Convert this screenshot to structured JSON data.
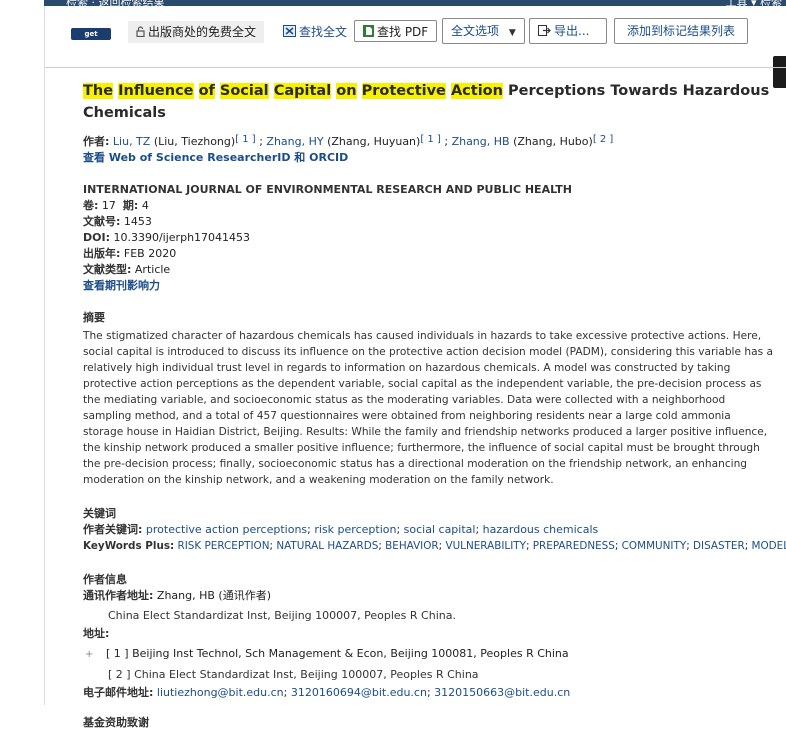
{
  "topbar": {
    "left_text": "检索   ·   返回检索结果",
    "right_text": "工具 ▾    检索"
  },
  "toolbar": {
    "getit_label": "get it@BIT",
    "free_fulltext": "出版商处的免费全文",
    "find_fulltext": "查找全文",
    "find_pdf": "查找 PDF",
    "fulltext_options": "全文选项",
    "export": "导出...",
    "add_to_marked": "添加到标记结果列表"
  },
  "record": {
    "title_highlighted": [
      "The",
      "Influence",
      "of",
      "Social",
      "Capital",
      "on",
      "Protective",
      "Action"
    ],
    "title_rest": "Perceptions Towards Hazardous Chemicals",
    "authors_label": "作者:",
    "authors": [
      {
        "name": "Liu, TZ",
        "full": "(Liu, Tiezhong)",
        "ref": "[ 1 ]"
      },
      {
        "name": "Zhang, HY",
        "full": "(Zhang, Huyuan)",
        "ref": "[ 1 ]"
      },
      {
        "name": "Zhang, HB",
        "full": "(Zhang, Hubo)",
        "ref": "[ 2 ]"
      }
    ],
    "researcher_link": "查看 Web of Science ResearcherID 和 ORCID",
    "journal": "INTERNATIONAL JOURNAL OF ENVIRONMENTAL RESEARCH AND PUBLIC HEALTH",
    "volume_label": "卷:",
    "volume": "17",
    "issue_label": "期:",
    "issue": "4",
    "article_no_label": "文献号:",
    "article_no": "1453",
    "doi_label": "DOI:",
    "doi": "10.3390/ijerph17041453",
    "pub_date_label": "出版年:",
    "pub_date": "FEB 2020",
    "doc_type_label": "文献类型:",
    "doc_type": "Article",
    "journal_impact_link": "查看期刊影响力",
    "abstract_heading": "摘要",
    "abstract": "The stigmatized character of hazardous chemicals has caused individuals in hazards to take excessive protective actions. Here, social capital is introduced to discuss its influence on the protective action decision model (PADM), considering this variable has a relatively high individual trust level in regards to information on hazardous chemicals. A model was constructed by taking protective action perceptions as the dependent variable, social capital as the independent variable, the pre-decision process as the mediating variable, and socioeconomic status as the moderating variables. Data were collected with a neighborhood sampling method, and a total of 457 questionnaires were obtained from neighboring residents near a large cold ammonia storage house in Haidian District, Beijing. Results: While the family and friendship networks produced a larger positive influence, the kinship network produced a smaller positive influence; furthermore, the influence of social capital must be brought through the pre-decision process; finally, socioeconomic status has a directional moderation on the friendship network, an enhancing moderation on the kinship network, and a weakening moderation on the family network.",
    "keywords_heading": "关键词",
    "author_keywords_label": "作者关键词:",
    "author_keywords": [
      "protective action perceptions",
      "risk perception",
      "social capital",
      "hazardous chemicals"
    ],
    "keywords_plus_label": "KeyWords Plus:",
    "keywords_plus": [
      "RISK PERCEPTION",
      "NATURAL HAZARDS",
      "BEHAVIOR",
      "VULNERABILITY",
      "PREPAREDNESS",
      "COMMUNITY",
      "DISASTER",
      "MODEL"
    ],
    "author_info_heading": "作者信息",
    "corresponding_label": "通讯作者地址:",
    "corresponding_author": "Zhang, HB (通讯作者)",
    "corresponding_addr": "China Elect Standardizat Inst, Beijing 100007, Peoples R China.",
    "address_label": "地址:",
    "addresses": [
      "[ 1 ] Beijing Inst Technol, Sch Management & Econ, Beijing 100081, Peoples R China",
      "[ 2 ] China Elect Standardizat Inst, Beijing 100007, Peoples R China"
    ],
    "email_label": "电子邮件地址:",
    "emails": [
      "liutiezhong@bit.edu.cn",
      "3120160694@bit.edu.cn",
      "3120150663@bit.edu.cn"
    ],
    "funding_heading": "基金资助致谢"
  }
}
